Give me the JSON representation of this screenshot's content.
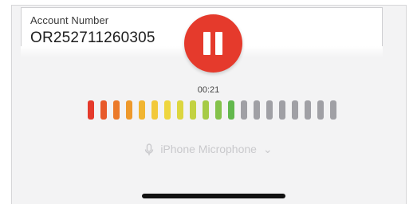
{
  "account": {
    "label": "Account Number",
    "value": "OR252711260305"
  },
  "recording": {
    "timer": "00:21",
    "state": "recording",
    "level_bars_lit": 12,
    "level_bars_total": 20,
    "bar_colors": [
      "#e53a2c",
      "#e85a2a",
      "#eb7a2a",
      "#ee992b",
      "#f1b531",
      "#f2c93a",
      "#eed63e",
      "#dcd63f",
      "#c3d242",
      "#a6cb46",
      "#84c24a",
      "#62b84d",
      "#a0a0a5",
      "#a0a0a5",
      "#a0a0a5",
      "#a0a0a5",
      "#a0a0a5",
      "#a0a0a5",
      "#a0a0a5",
      "#a0a0a5"
    ]
  },
  "microphone": {
    "icon": "microphone-icon",
    "label": "iPhone Microphone",
    "chevron": "⌄"
  },
  "colors": {
    "pause_button": "#e53a2c",
    "inactive_bar": "#a0a0a5"
  }
}
